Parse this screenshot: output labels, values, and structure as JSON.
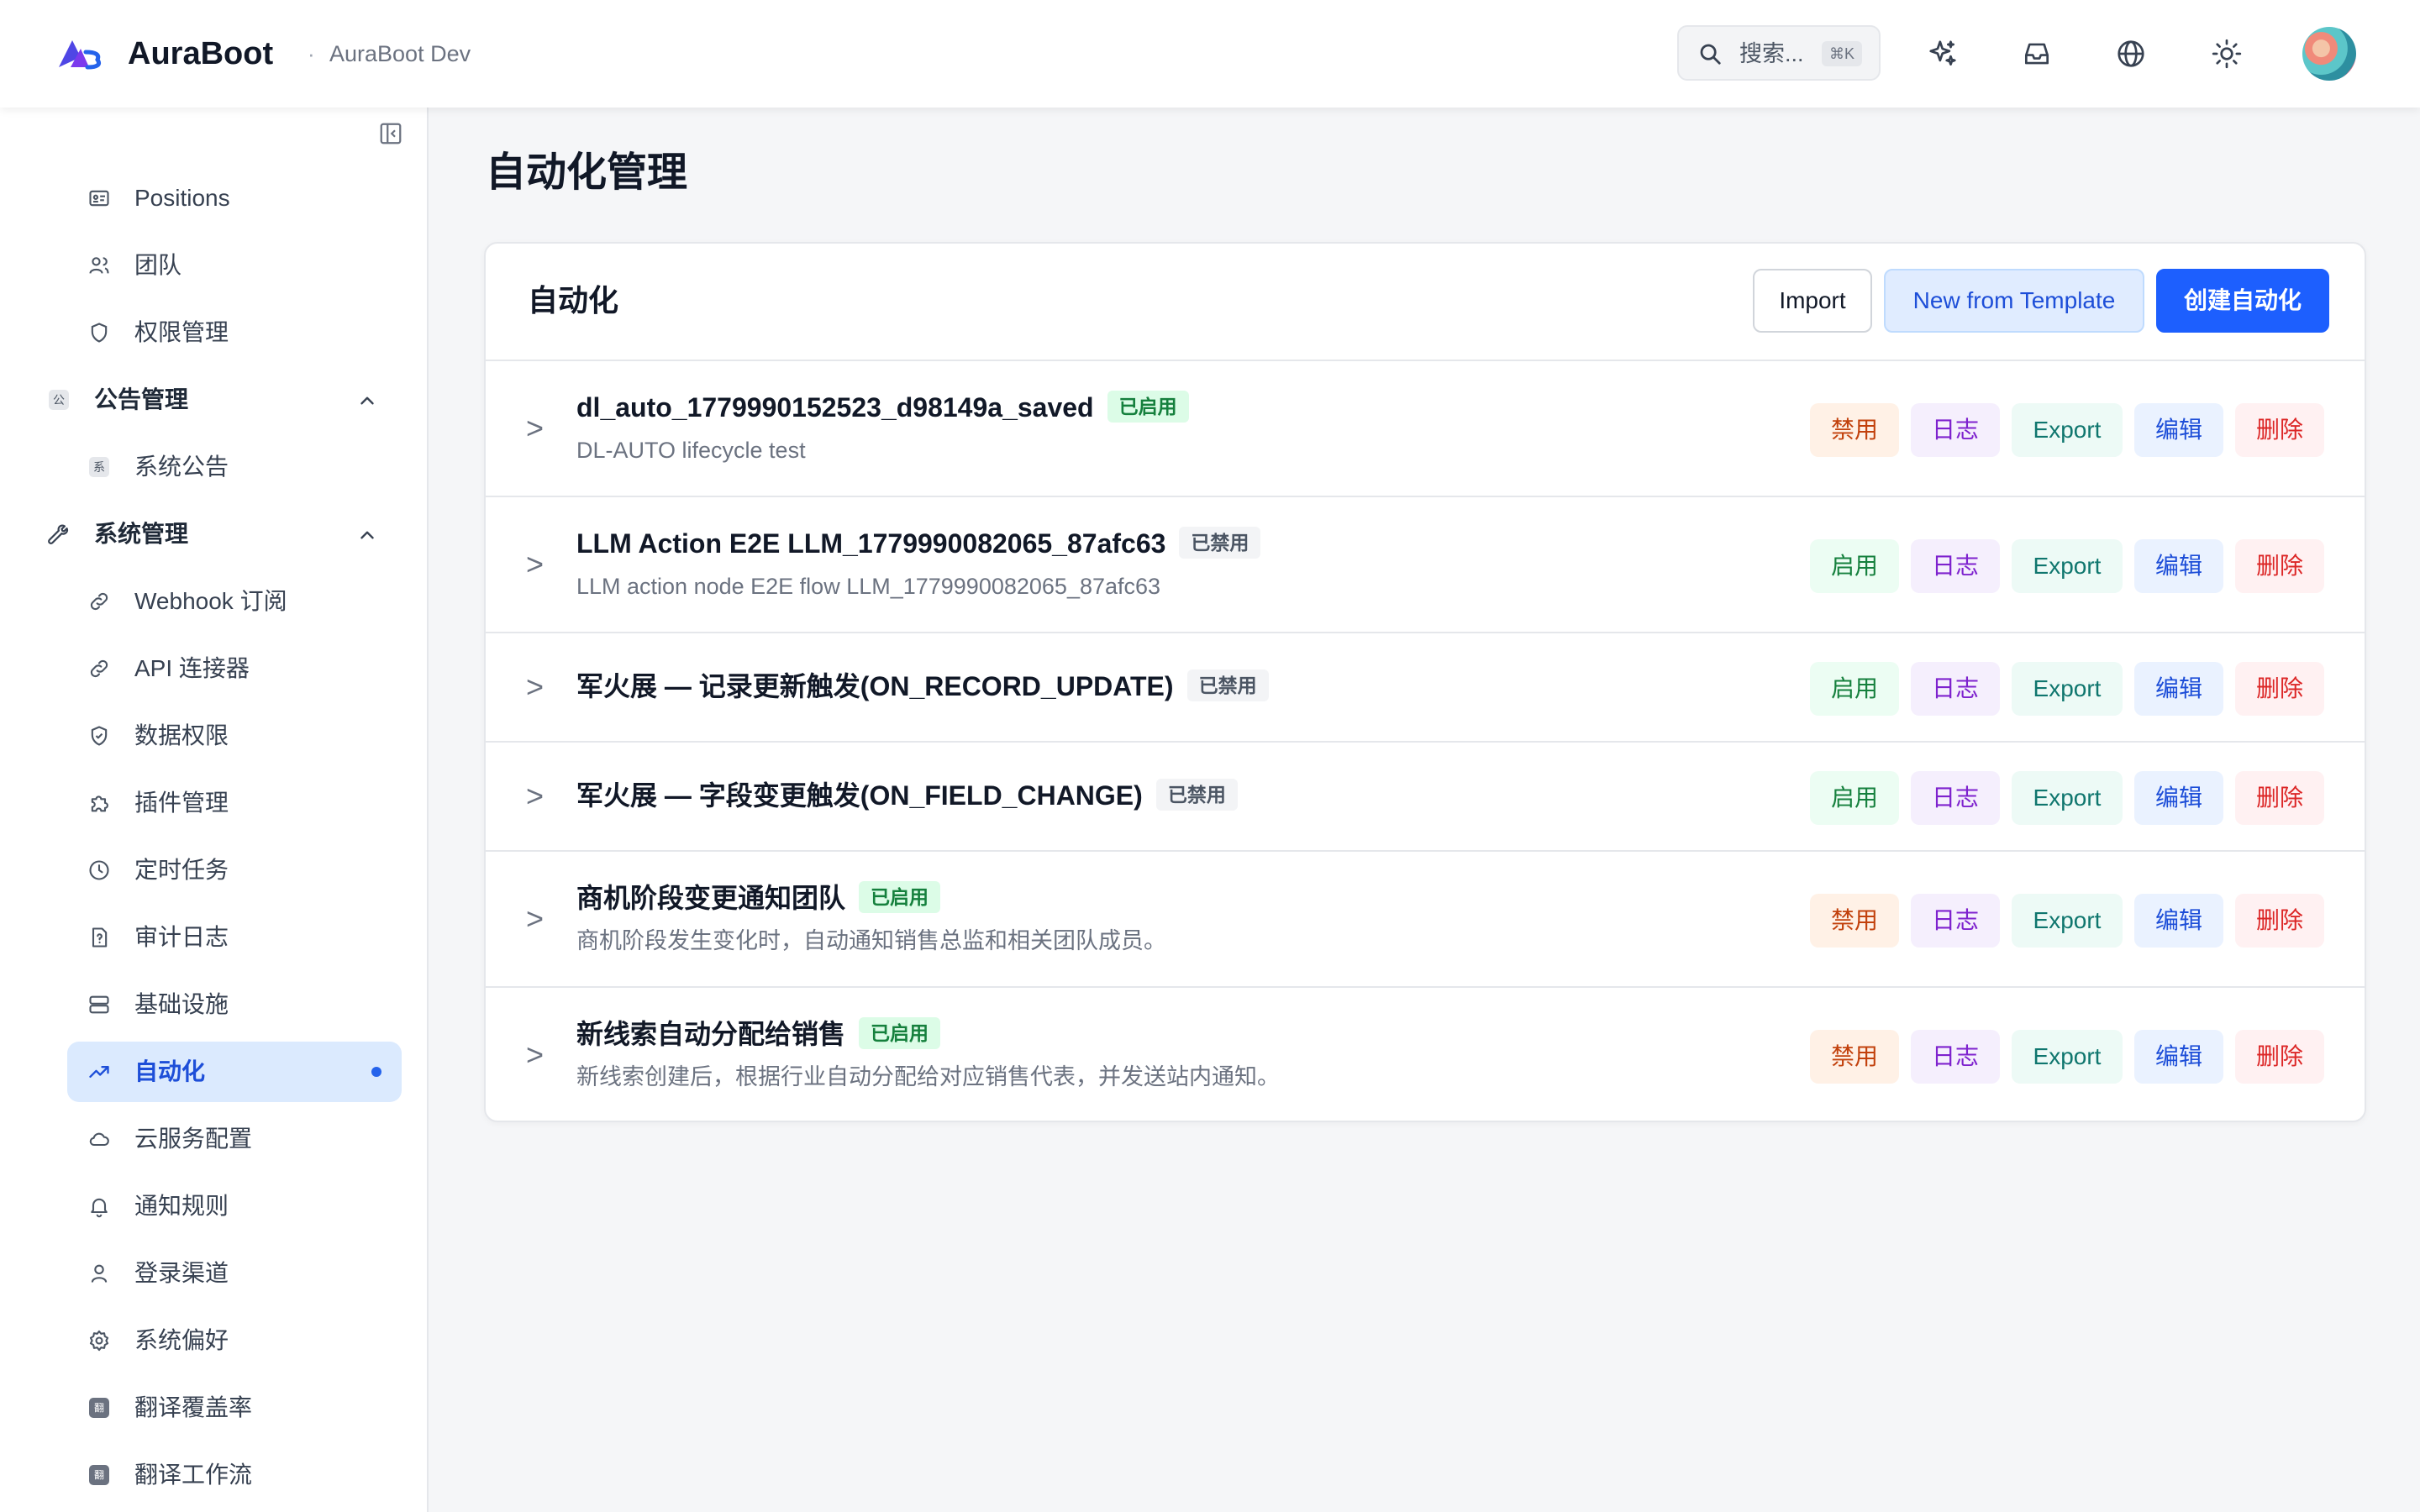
{
  "header": {
    "brand": "AuraBoot",
    "separator": "·",
    "environment": "AuraBoot Dev",
    "search_placeholder": "搜索...",
    "search_shortcut": "⌘K",
    "icons": [
      "sparkles-icon",
      "inbox-icon",
      "globe-icon",
      "sun-icon"
    ]
  },
  "sidebar": {
    "items": [
      {
        "label": "Positions",
        "icon": "id-card-icon"
      },
      {
        "label": "团队",
        "icon": "users-icon"
      },
      {
        "label": "权限管理",
        "icon": "shield-icon"
      },
      {
        "label": "公告管理",
        "icon": "公",
        "group": true,
        "expanded": true
      },
      {
        "label": "系统公告",
        "icon": "系"
      },
      {
        "label": "系统管理",
        "icon": "wrench-icon",
        "group": true,
        "expanded": true
      },
      {
        "label": "Webhook 订阅",
        "icon": "link-icon"
      },
      {
        "label": "API 连接器",
        "icon": "link-icon"
      },
      {
        "label": "数据权限",
        "icon": "shield-check-icon"
      },
      {
        "label": "插件管理",
        "icon": "puzzle-icon"
      },
      {
        "label": "定时任务",
        "icon": "clock-icon"
      },
      {
        "label": "审计日志",
        "icon": "file-question-icon"
      },
      {
        "label": "基础设施",
        "icon": "server-icon"
      },
      {
        "label": "自动化",
        "icon": "trending-up-icon",
        "active": true
      },
      {
        "label": "云服务配置",
        "icon": "cloud-icon"
      },
      {
        "label": "通知规则",
        "icon": "bell-icon"
      },
      {
        "label": "登录渠道",
        "icon": "user-icon"
      },
      {
        "label": "系统偏好",
        "icon": "gear-icon"
      },
      {
        "label": "翻译覆盖率",
        "icon": "翻"
      },
      {
        "label": "翻译工作流",
        "icon": "翻"
      }
    ]
  },
  "main": {
    "page_title": "自动化管理",
    "card_title": "自动化",
    "buttons": {
      "import": "Import",
      "template": "New from Template",
      "create": "创建自动化"
    },
    "expand_symbol": ">",
    "actions": {
      "enable": "启用",
      "disable": "禁用",
      "log": "日志",
      "export": "Export",
      "edit": "编辑",
      "delete": "删除"
    },
    "rows": [
      {
        "name": "dl_auto_1779990152523_d98149a_saved",
        "status": "已启用",
        "enabled": true,
        "description": "DL-AUTO lifecycle test"
      },
      {
        "name": "LLM Action E2E LLM_1779990082065_87afc63",
        "status": "已禁用",
        "enabled": false,
        "description": "LLM action node E2E flow LLM_1779990082065_87afc63"
      },
      {
        "name": "军火展 — 记录更新触发(ON_RECORD_UPDATE)",
        "status": "已禁用",
        "enabled": false,
        "description": ""
      },
      {
        "name": "军火展 — 字段变更触发(ON_FIELD_CHANGE)",
        "status": "已禁用",
        "enabled": false,
        "description": ""
      },
      {
        "name": "商机阶段变更通知团队",
        "status": "已启用",
        "enabled": true,
        "description": "商机阶段发生变化时，自动通知销售总监和相关团队成员。"
      },
      {
        "name": "新线索自动分配给销售",
        "status": "已启用",
        "enabled": true,
        "description": "新线索创建后，根据行业自动分配给对应销售代表，并发送站内通知。"
      }
    ]
  },
  "colors": {
    "accent": "#1d5ffe",
    "active_bg": "#dbeafe",
    "enabled_badge": "#dcfce7",
    "disabled_badge": "#f3f4f6"
  }
}
